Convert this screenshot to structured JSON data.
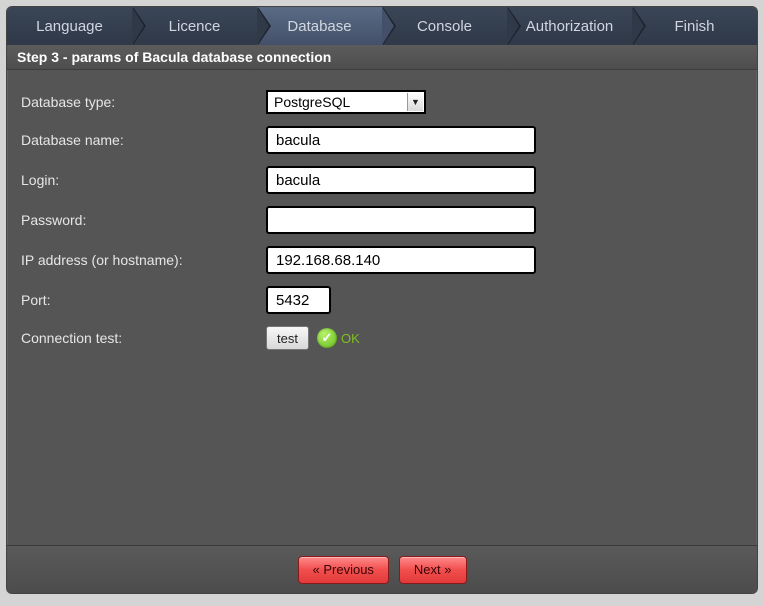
{
  "tabs": [
    "Language",
    "Licence",
    "Database",
    "Console",
    "Authorization",
    "Finish"
  ],
  "active_tab_index": 2,
  "title": "Step 3 - params of Bacula database connection",
  "labels": {
    "db_type": "Database type:",
    "db_name": "Database name:",
    "login": "Login:",
    "password": "Password:",
    "ip": "IP address (or hostname):",
    "port": "Port:",
    "conn_test": "Connection test:"
  },
  "values": {
    "db_type": "PostgreSQL",
    "db_name": "bacula",
    "login": "bacula",
    "password": "",
    "ip": "192.168.68.140",
    "port": "5432"
  },
  "test_button": "test",
  "status_text": "OK",
  "footer": {
    "prev": "« Previous",
    "next": "Next »"
  }
}
